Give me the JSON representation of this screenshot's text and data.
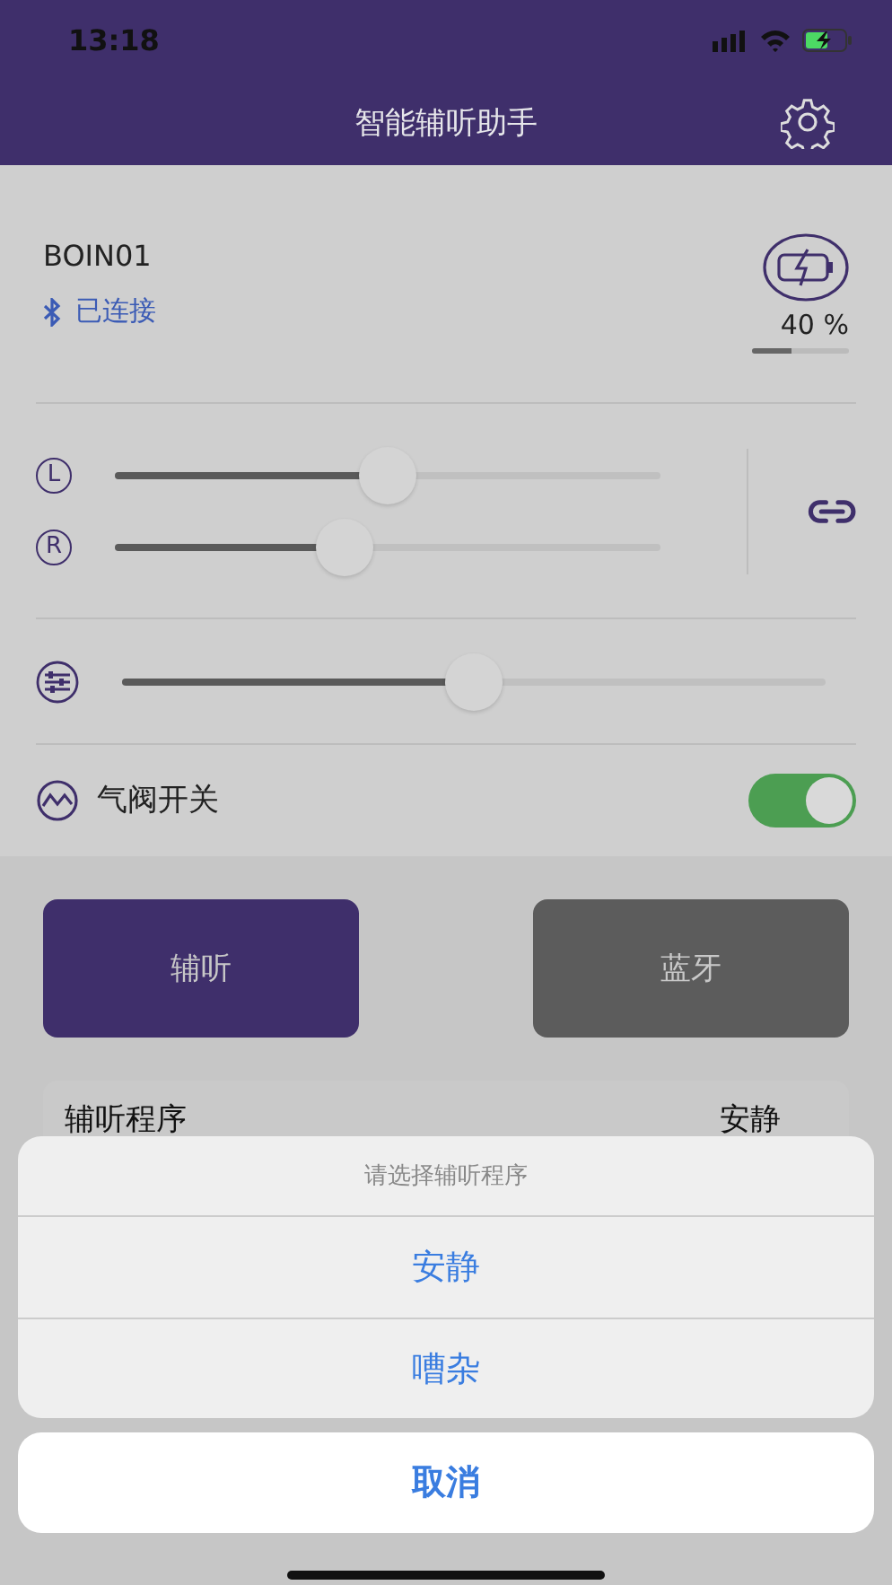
{
  "status_bar": {
    "time": "13:18"
  },
  "header": {
    "title": "智能辅听助手"
  },
  "device": {
    "name": "BOIN01",
    "connection": "已连接",
    "battery": {
      "reading": "40 %",
      "level": 0.4
    }
  },
  "volume": {
    "sliders": [
      {
        "side": "L",
        "level": 0.5
      },
      {
        "side": "R",
        "level": 0.42
      }
    ]
  },
  "balance": {
    "level": 0.5
  },
  "valve": {
    "label": "气阀开关",
    "on": true
  },
  "mode_buttons": [
    {
      "label": "辅听",
      "selected": true
    },
    {
      "label": "蓝牙",
      "selected": false
    }
  ],
  "program_row": {
    "label": "辅听程序",
    "value": "安静"
  },
  "action_sheet": {
    "title": "请选择辅听程序",
    "options": [
      "安静",
      "嘈杂"
    ],
    "cancel": "取消"
  }
}
